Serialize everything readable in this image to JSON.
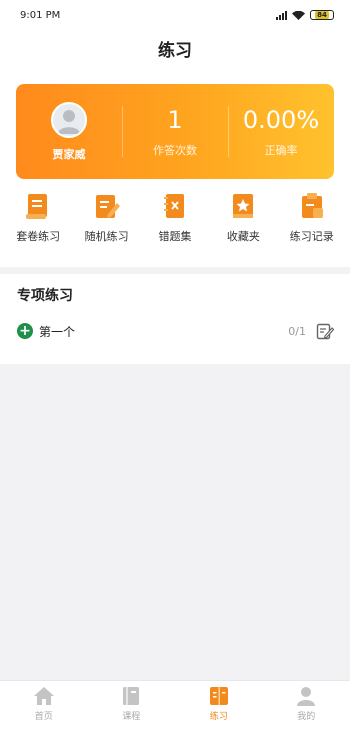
{
  "status_bar": {
    "time": "9:01 PM",
    "battery": "84"
  },
  "header": {
    "title": "练习"
  },
  "profile_card": {
    "user_name": "贾家威",
    "answer_count": "1",
    "answer_count_label": "作答次数",
    "accuracy": "0.00%",
    "accuracy_label": "正确率"
  },
  "shortcuts": [
    {
      "label": "套卷练习",
      "icon": "paper-set-icon"
    },
    {
      "label": "随机练习",
      "icon": "random-practice-icon"
    },
    {
      "label": "错题集",
      "icon": "wrong-questions-icon"
    },
    {
      "label": "收藏夹",
      "icon": "favorites-icon"
    },
    {
      "label": "练习记录",
      "icon": "practice-record-icon"
    }
  ],
  "special_practice": {
    "title": "专项练习",
    "items": [
      {
        "name": "第一个",
        "progress": "0/1"
      }
    ]
  },
  "tabbar": {
    "items": [
      {
        "label": "首页",
        "icon": "home-icon"
      },
      {
        "label": "课程",
        "icon": "course-icon"
      },
      {
        "label": "练习",
        "icon": "practice-icon",
        "active": true
      },
      {
        "label": "我的",
        "icon": "profile-icon"
      }
    ]
  },
  "colors": {
    "accent": "#f28a1d",
    "card_start": "#ff8a1c",
    "card_end": "#ffc22e",
    "green": "#1f8f4a"
  }
}
